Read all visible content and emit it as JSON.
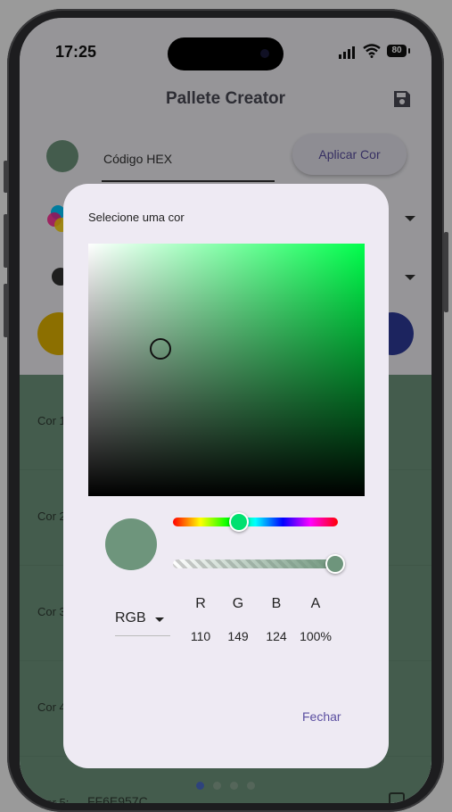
{
  "status": {
    "time": "17:25",
    "battery": "80"
  },
  "app": {
    "title": "Pallete Creator"
  },
  "hex_field": {
    "label": "Código HEX"
  },
  "apply": {
    "label": "Aplicar Cor"
  },
  "colors": {
    "swatch": "#6e957c",
    "yellow": "#e2b400",
    "blue": "#2e3a9a",
    "row_background": "#6e957c",
    "rows": [
      {
        "label": "Cor 1:",
        "hex": ""
      },
      {
        "label": "Cor 2:",
        "hex": ""
      },
      {
        "label": "Cor 3:",
        "hex": ""
      },
      {
        "label": "Cor 4:",
        "hex": ""
      },
      {
        "label": "Cor 5:",
        "hex": "FF6E957C"
      }
    ]
  },
  "dialog": {
    "title": "Selecione uma cor",
    "color_mode": "RGB",
    "channels": [
      {
        "name": "R",
        "value": "110"
      },
      {
        "name": "G",
        "value": "149"
      },
      {
        "name": "B",
        "value": "124"
      },
      {
        "name": "A",
        "value": "100%"
      }
    ],
    "close_label": "Fechar",
    "hue_fraction": 0.39,
    "alpha_fraction": 1.0
  }
}
